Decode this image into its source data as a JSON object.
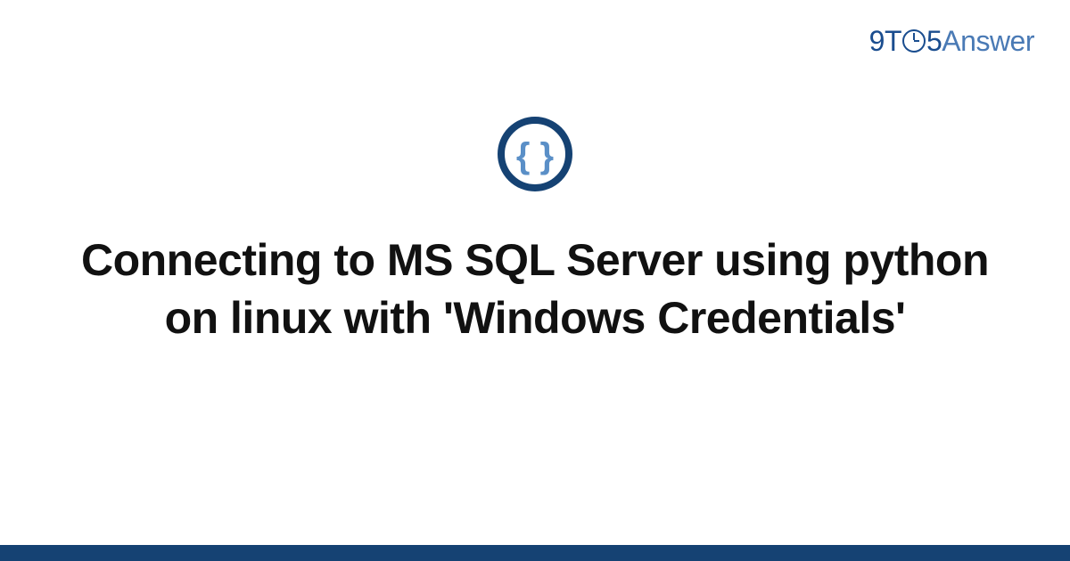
{
  "logo": {
    "nine": "9",
    "t": "T",
    "five": "5",
    "answer": "Answer"
  },
  "icon": {
    "name": "code-braces-icon"
  },
  "title": "Connecting to MS SQL Server using python on linux with 'Windows Credentials'"
}
